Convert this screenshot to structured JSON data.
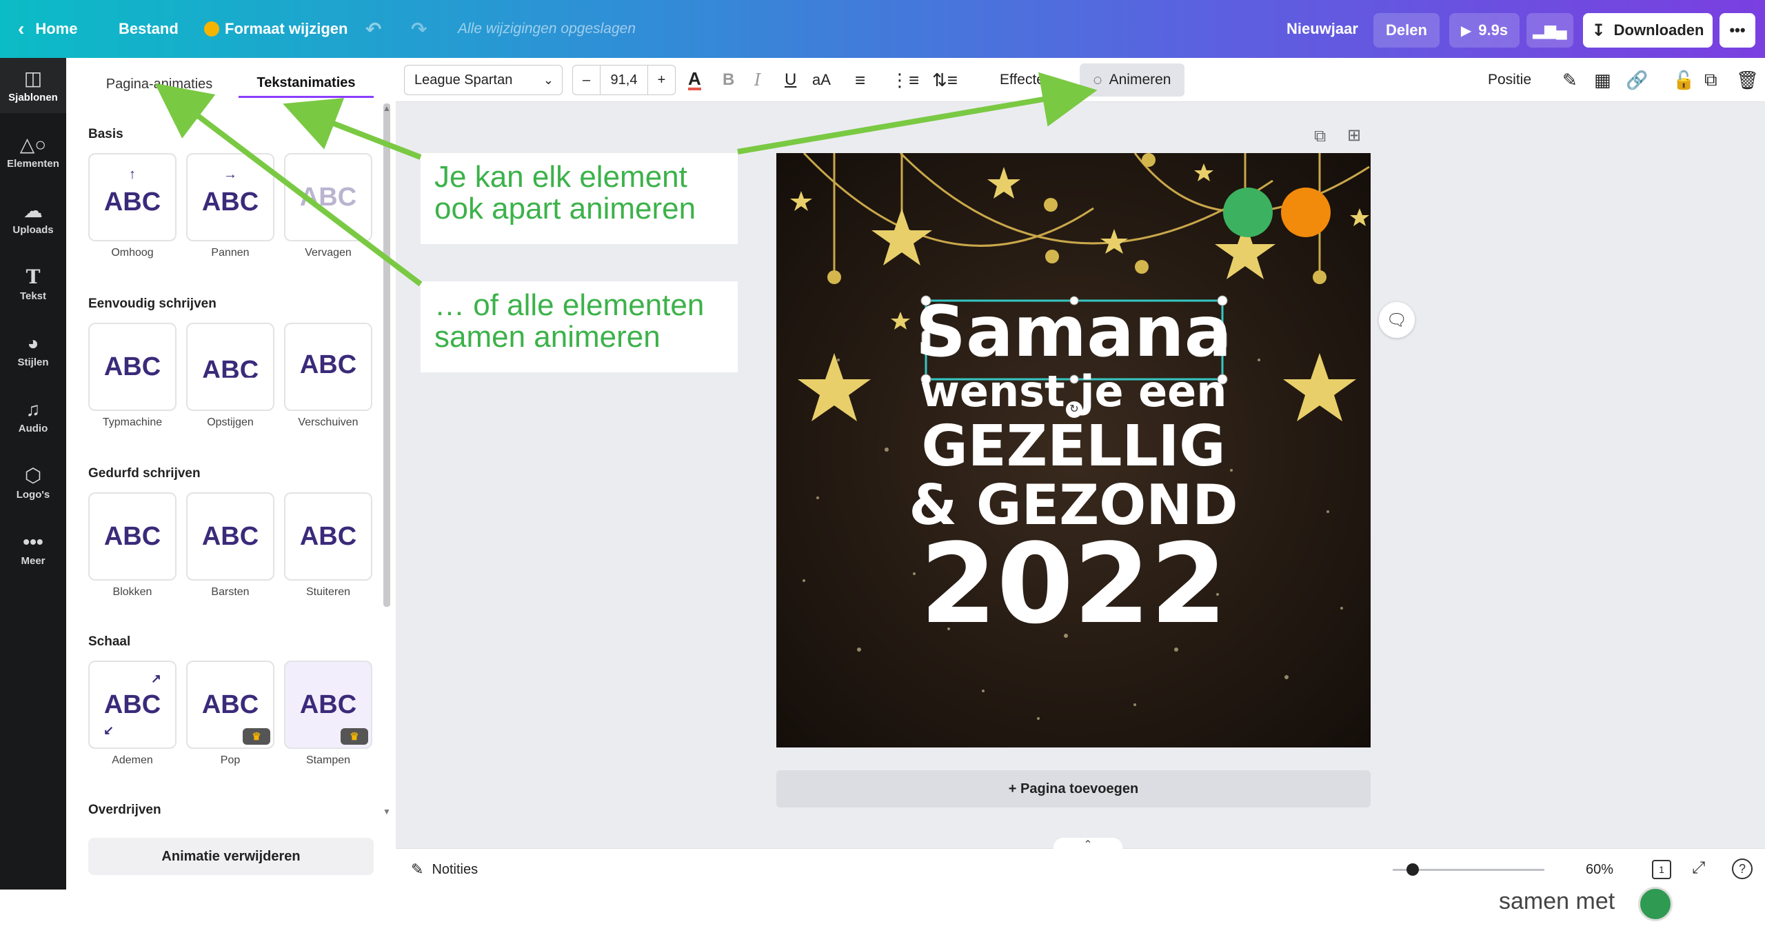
{
  "topbar": {
    "home": "Home",
    "file": "Bestand",
    "resize": "Formaat wijzigen",
    "status": "Alle wijzigingen opgeslagen",
    "doc_title": "Nieuwjaar",
    "share": "Delen",
    "play_duration": "9.9s",
    "download": "Downloaden",
    "more": "•••"
  },
  "rail": {
    "items": [
      {
        "label": "Sjablonen",
        "icon": "layout-icon"
      },
      {
        "label": "Elementen",
        "icon": "shapes-icon"
      },
      {
        "label": "Uploads",
        "icon": "cloud-upload-icon"
      },
      {
        "label": "Tekst",
        "icon": "text-icon"
      },
      {
        "label": "Stijlen",
        "icon": "palette-icon"
      },
      {
        "label": "Audio",
        "icon": "music-icon"
      },
      {
        "label": "Logo's",
        "icon": "logo-icon"
      },
      {
        "label": "Meer",
        "icon": "more-icon"
      }
    ]
  },
  "panel": {
    "tab_page": "Pagina-animaties",
    "tab_text": "Tekstanimaties",
    "sections": [
      {
        "title": "Basis",
        "items": [
          "Omhoog",
          "Pannen",
          "Vervagen"
        ]
      },
      {
        "title": "Eenvoudig schrijven",
        "items": [
          "Typmachine",
          "Opstijgen",
          "Verschuiven"
        ]
      },
      {
        "title": "Gedurfd schrijven",
        "items": [
          "Blokken",
          "Barsten",
          "Stuiteren"
        ]
      },
      {
        "title": "Schaal",
        "items": [
          "Ademen",
          "Pop",
          "Stampen"
        ]
      }
    ],
    "next_section": "Overdrijven",
    "card_text": "ABC",
    "remove": "Animatie verwijderen"
  },
  "toolbar": {
    "font": "League Spartan",
    "size": "91,4",
    "minus": "–",
    "plus": "+",
    "effects": "Effecten",
    "animate": "Animeren",
    "position": "Positie"
  },
  "canvas": {
    "line1": "Samana",
    "line2": "wenst je een",
    "line3": "GEZELLIG",
    "line4": "& GEZOND",
    "line5": "2022",
    "add_page": "+ Pagina toevoegen"
  },
  "callouts": {
    "top": "Je kan elk element ook apart animeren",
    "bottom": "… of alle elementen samen animeren"
  },
  "bottombar": {
    "notes": "Notities",
    "zoom": "60%",
    "page": "1"
  },
  "footer": {
    "partial_text": "samen met"
  },
  "colors": {
    "accent": "#8b3dff",
    "callout_green": "#3cb24a",
    "arrow_green": "#7ac943"
  }
}
